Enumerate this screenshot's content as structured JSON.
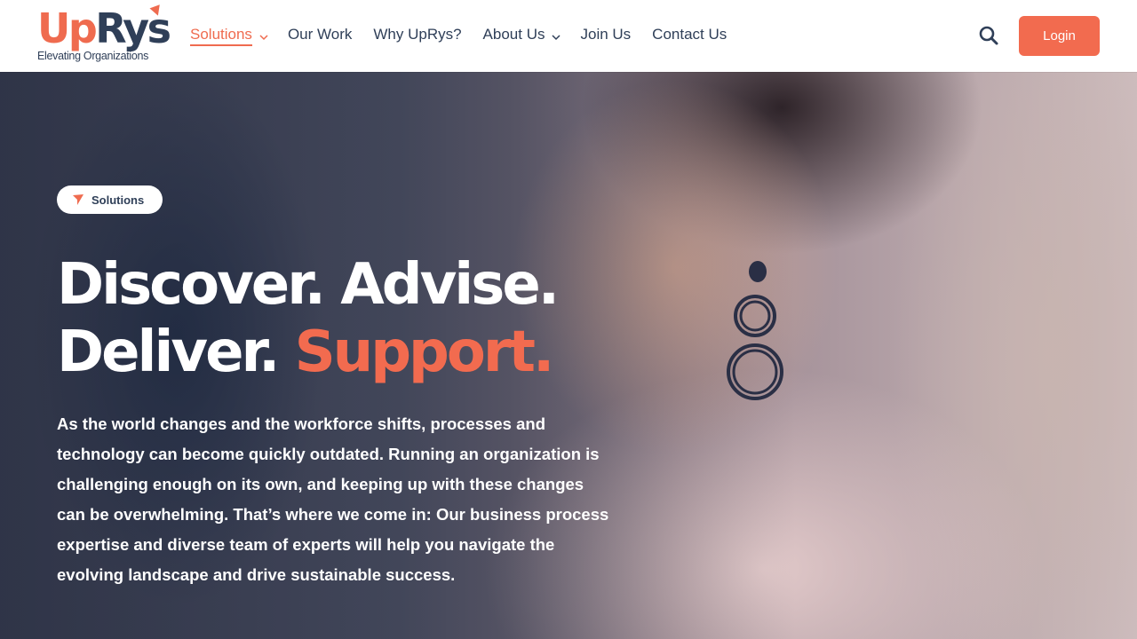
{
  "brand": {
    "name_part1": "Up",
    "name_part2": "Rys",
    "tagline": "Elevating Organizations",
    "accent_color": "#f26b4f",
    "navy_color": "#2f3f58"
  },
  "nav": {
    "items": [
      {
        "label": "Solutions",
        "active": true,
        "dropdown": true
      },
      {
        "label": "Our Work",
        "active": false,
        "dropdown": false
      },
      {
        "label": "Why UpRys?",
        "active": false,
        "dropdown": false
      },
      {
        "label": "About Us",
        "active": false,
        "dropdown": true
      },
      {
        "label": "Join Us",
        "active": false,
        "dropdown": false
      },
      {
        "label": "Contact Us",
        "active": false,
        "dropdown": false
      }
    ],
    "search_icon": "search-icon",
    "login_label": "Login"
  },
  "hero": {
    "badge_label": "Solutions",
    "badge_icon": "arrow-pointer-icon",
    "headline_line1": "Discover. Advise.",
    "headline_line2_plain": "Deliver.",
    "headline_line2_accent": "Support.",
    "body": "As the world changes and the workforce shifts, processes and technology can become quickly outdated. Running an organization is challenging enough on its own, and keeping up with these changes can be overwhelming. That’s where we come in: Our business process expertise and diverse team of experts will help you navigate the evolving landscape and drive sustainable success."
  }
}
